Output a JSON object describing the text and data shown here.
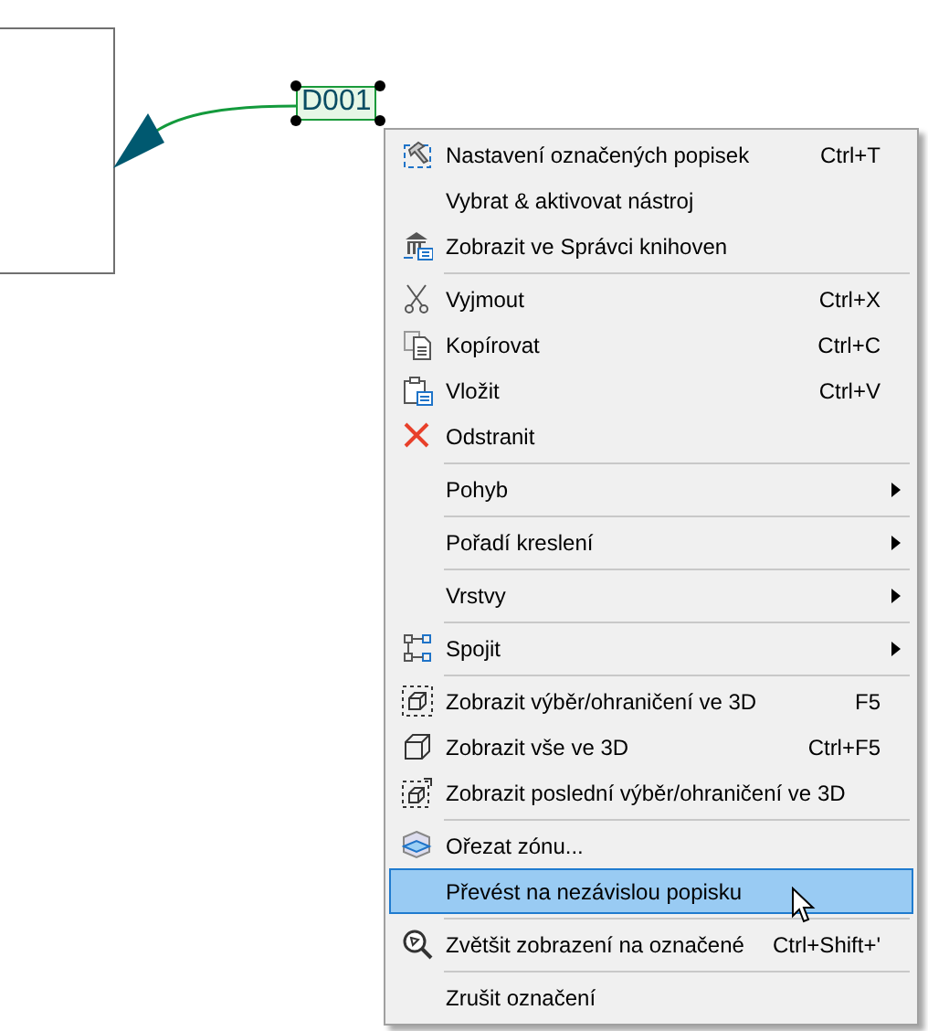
{
  "canvas": {
    "label": "D001",
    "label_selected": true
  },
  "context_menu": {
    "items": [
      {
        "kind": "command",
        "label": "Nastavení označených popisek",
        "shortcut": "Ctrl+T",
        "selected": false
      },
      {
        "kind": "command",
        "label": "Vybrat & aktivovat nástroj",
        "selected": false
      },
      {
        "kind": "command",
        "label": "Zobrazit ve Správci knihoven",
        "selected": false
      },
      {
        "kind": "separator"
      },
      {
        "kind": "command",
        "label": "Vyjmout",
        "shortcut": "Ctrl+X",
        "selected": false
      },
      {
        "kind": "command",
        "label": "Kopírovat",
        "shortcut": "Ctrl+C",
        "selected": false
      },
      {
        "kind": "command",
        "label": "Vložit",
        "shortcut": "Ctrl+V",
        "selected": false
      },
      {
        "kind": "command",
        "label": "Odstranit",
        "selected": false
      },
      {
        "kind": "separator"
      },
      {
        "kind": "submenu",
        "label": "Pohyb",
        "selected": false
      },
      {
        "kind": "separator"
      },
      {
        "kind": "submenu",
        "label": "Pořadí kreslení",
        "selected": false
      },
      {
        "kind": "separator"
      },
      {
        "kind": "submenu",
        "label": "Vrstvy",
        "selected": false
      },
      {
        "kind": "separator"
      },
      {
        "kind": "submenu",
        "label": "Spojit",
        "selected": false
      },
      {
        "kind": "separator"
      },
      {
        "kind": "command",
        "label": "Zobrazit výběr/ohraničení ve 3D",
        "shortcut": "F5",
        "selected": false
      },
      {
        "kind": "command",
        "label": "Zobrazit vše ve 3D",
        "shortcut": "Ctrl+F5",
        "selected": false
      },
      {
        "kind": "command",
        "label": "Zobrazit poslední výběr/ohraničení ve 3D",
        "selected": false
      },
      {
        "kind": "separator"
      },
      {
        "kind": "command",
        "label": "Ořezat zónu...",
        "selected": false
      },
      {
        "kind": "command",
        "label": "Převést na nezávislou popisku",
        "selected": true
      },
      {
        "kind": "separator"
      },
      {
        "kind": "command",
        "label": "Zvětšit zobrazení na označené",
        "shortcut": "Ctrl+Shift+'",
        "selected": false
      },
      {
        "kind": "separator"
      },
      {
        "kind": "command",
        "label": "Zrušit označení",
        "selected": false
      }
    ]
  }
}
